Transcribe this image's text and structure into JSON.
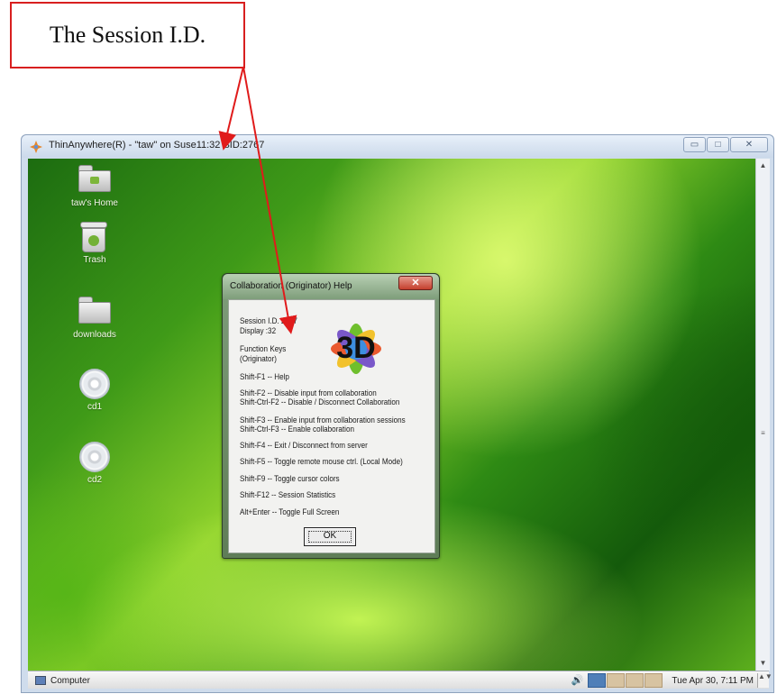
{
  "annotation": {
    "callout_text": "The Session I.D."
  },
  "window": {
    "title": "ThinAnywhere(R) - \"taw\" on Suse11:32  SID:2767",
    "controls": {
      "minimize": "▭",
      "maximize": "□",
      "close": "✕"
    }
  },
  "desktop": {
    "icons": [
      {
        "label": "taw's Home",
        "icon": "home-folder-icon"
      },
      {
        "label": "Trash",
        "icon": "trash-icon"
      },
      {
        "label": "downloads",
        "icon": "folder-icon"
      },
      {
        "label": "cd1",
        "icon": "cd-icon"
      },
      {
        "label": "cd2",
        "icon": "cd-icon"
      }
    ],
    "scrollbar": {
      "up": "▲",
      "down": "▼",
      "grip": "≡"
    }
  },
  "dialog": {
    "title": "Collaboration (Originator) Help",
    "close_glyph": "✕",
    "logo_text": "3D",
    "lines": {
      "session_id": "Session I.D. 2767",
      "display": "Display :32",
      "function_keys": "Function Keys",
      "originator": "(Originator)",
      "shift_f1": "Shift-F1  -- Help",
      "shift_f2": "Shift-F2      -- Disable input from collaboration",
      "shift_ctrl_f2": "Shift-Ctrl-F2 -- Disable / Disconnect Collaboration",
      "shift_f3": "Shift-F3      -- Enable input from collaboration sessions",
      "shift_ctrl_f3": "Shift-Ctrl-F3 -- Enable collaboration",
      "shift_f4": "Shift-F4      -- Exit / Disconnect from server",
      "shift_f5": "Shift-F5      -- Toggle remote mouse ctrl. (Local Mode)",
      "shift_f9": "Shift-F9      -- Toggle cursor colors",
      "shift_f12": "Shift-F12     -- Session Statistics",
      "alt_enter": "Alt+Enter   -- Toggle Full Screen"
    },
    "ok_label": "OK"
  },
  "taskbar": {
    "start_label": "Computer",
    "volume_icon": "🔊",
    "clock": "Tue Apr 30,  7:11 PM",
    "scroll_glyph": "▲▼"
  },
  "colors": {
    "callout_border": "#d81f1f",
    "arrow": "#e01b1b",
    "desktop_green": "#5faf1f",
    "workspace_active": "#4f7fb8"
  }
}
